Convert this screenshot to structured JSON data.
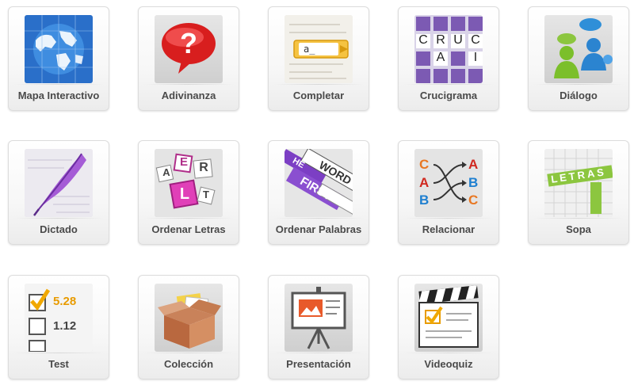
{
  "tiles": [
    {
      "label": "Mapa Interactivo",
      "icon": "globe-map-icon"
    },
    {
      "label": "Adivinanza",
      "icon": "question-bubble-icon"
    },
    {
      "label": "Completar",
      "icon": "fill-in-blank-icon",
      "icon_text": "a_"
    },
    {
      "label": "Crucigrama",
      "icon": "crossword-icon",
      "icon_letters": [
        "C",
        "R",
        "U",
        "C",
        "A",
        "I"
      ]
    },
    {
      "label": "Diálogo",
      "icon": "people-chat-icon"
    },
    {
      "label": "Dictado",
      "icon": "quill-pen-icon"
    },
    {
      "label": "Ordenar Letras",
      "icon": "letter-blocks-icon",
      "icon_letters": [
        "A",
        "E",
        "R",
        "L",
        "T"
      ]
    },
    {
      "label": "Ordenar Palabras",
      "icon": "word-strips-icon",
      "icon_words": [
        "HE",
        "WORD",
        "FIRST"
      ]
    },
    {
      "label": "Relacionar",
      "icon": "match-arrows-icon",
      "icon_letters": [
        "C",
        "A",
        "B",
        "A",
        "B",
        "C"
      ]
    },
    {
      "label": "Sopa",
      "icon": "word-search-icon",
      "icon_word": "LETRAS"
    },
    {
      "label": "Test",
      "icon": "checklist-icon",
      "icon_values": [
        "5.28",
        "1.12"
      ]
    },
    {
      "label": "Colección",
      "icon": "box-files-icon"
    },
    {
      "label": "Presentación",
      "icon": "easel-chart-icon"
    },
    {
      "label": "Videoquiz",
      "icon": "clapperboard-quiz-icon"
    }
  ]
}
